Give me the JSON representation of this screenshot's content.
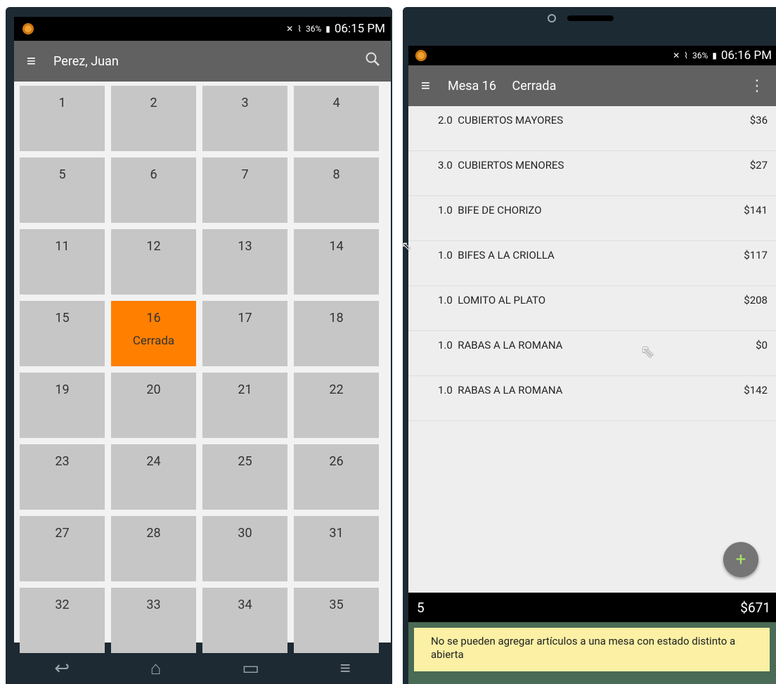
{
  "left_screen": {
    "status": {
      "battery": "36%",
      "time": "06:15 PM"
    },
    "toolbar": {
      "title": "Perez, Juan"
    },
    "tables": [
      {
        "number": "1",
        "state": ""
      },
      {
        "number": "2",
        "state": ""
      },
      {
        "number": "3",
        "state": ""
      },
      {
        "number": "4",
        "state": ""
      },
      {
        "number": "5",
        "state": ""
      },
      {
        "number": "6",
        "state": ""
      },
      {
        "number": "7",
        "state": ""
      },
      {
        "number": "8",
        "state": ""
      },
      {
        "number": "11",
        "state": ""
      },
      {
        "number": "12",
        "state": ""
      },
      {
        "number": "13",
        "state": ""
      },
      {
        "number": "14",
        "state": ""
      },
      {
        "number": "15",
        "state": ""
      },
      {
        "number": "16",
        "state": "Cerrada"
      },
      {
        "number": "17",
        "state": ""
      },
      {
        "number": "18",
        "state": ""
      },
      {
        "number": "19",
        "state": ""
      },
      {
        "number": "20",
        "state": ""
      },
      {
        "number": "21",
        "state": ""
      },
      {
        "number": "22",
        "state": ""
      },
      {
        "number": "23",
        "state": ""
      },
      {
        "number": "24",
        "state": ""
      },
      {
        "number": "25",
        "state": ""
      },
      {
        "number": "26",
        "state": ""
      },
      {
        "number": "27",
        "state": ""
      },
      {
        "number": "28",
        "state": ""
      },
      {
        "number": "30",
        "state": ""
      },
      {
        "number": "31",
        "state": ""
      },
      {
        "number": "32",
        "state": ""
      },
      {
        "number": "33",
        "state": ""
      },
      {
        "number": "34",
        "state": ""
      },
      {
        "number": "35",
        "state": ""
      }
    ],
    "icons": [
      "menu-icon",
      "search-icon",
      "back-icon",
      "home-icon",
      "recent-apps-icon",
      "menu-nav-icon"
    ]
  },
  "right_screen": {
    "status": {
      "battery": "36%",
      "time": "06:16 PM"
    },
    "toolbar": {
      "title": "Mesa 16",
      "status": "Cerrada"
    },
    "items": [
      {
        "desc": "2.0  CUBIERTOS MAYORES",
        "price": "$36"
      },
      {
        "desc": "3.0  CUBIERTOS MENORES",
        "price": "$27"
      },
      {
        "desc": "1.0  BIFE DE CHORIZO",
        "price": "$141"
      },
      {
        "desc": "1.0  BIFES A LA CRIOLLA",
        "price": "$117"
      },
      {
        "desc": "1.0  LOMITO AL PLATO",
        "price": "$208"
      },
      {
        "desc": "1.0  RABAS A LA ROMANA",
        "price": "$0"
      },
      {
        "desc": "1.0  RABAS A LA ROMANA",
        "price": "$142"
      }
    ],
    "fab_symbol": "+",
    "total": {
      "count": "5",
      "amount": "$671"
    },
    "toast": "No se pueden agregar artículos a una mesa con estado distinto a abierta"
  },
  "colors": {
    "toolbar": "#616161",
    "table_free": "#c6c6c6",
    "table_closed": "#ff7f00",
    "toast": "#fbf0a4"
  }
}
